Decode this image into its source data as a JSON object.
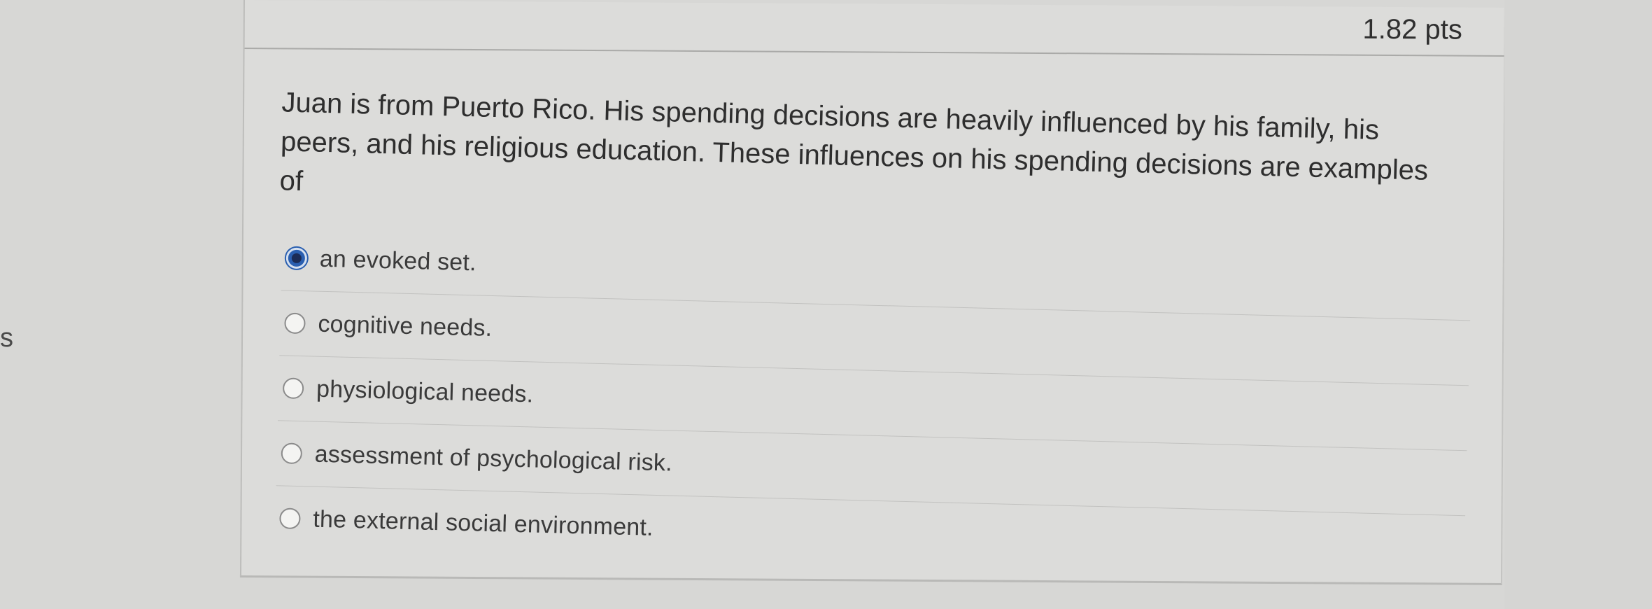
{
  "sidebar": {
    "edge_letter": "s"
  },
  "question": {
    "points": "1.82 pts",
    "text": "Juan is from Puerto Rico. His spending decisions are heavily influenced by his family, his peers, and his religious education. These influences on his spending decisions are examples of",
    "answers": [
      {
        "label": "an evoked set.",
        "selected": true
      },
      {
        "label": "cognitive needs.",
        "selected": false
      },
      {
        "label": "physiological needs.",
        "selected": false
      },
      {
        "label": "assessment of psychological risk.",
        "selected": false
      },
      {
        "label": "the external social environment.",
        "selected": false
      }
    ]
  },
  "colors": {
    "radio_selected": "#2a5fb0",
    "page_background": "#d7d7d5",
    "text": "#2e2e2e"
  }
}
